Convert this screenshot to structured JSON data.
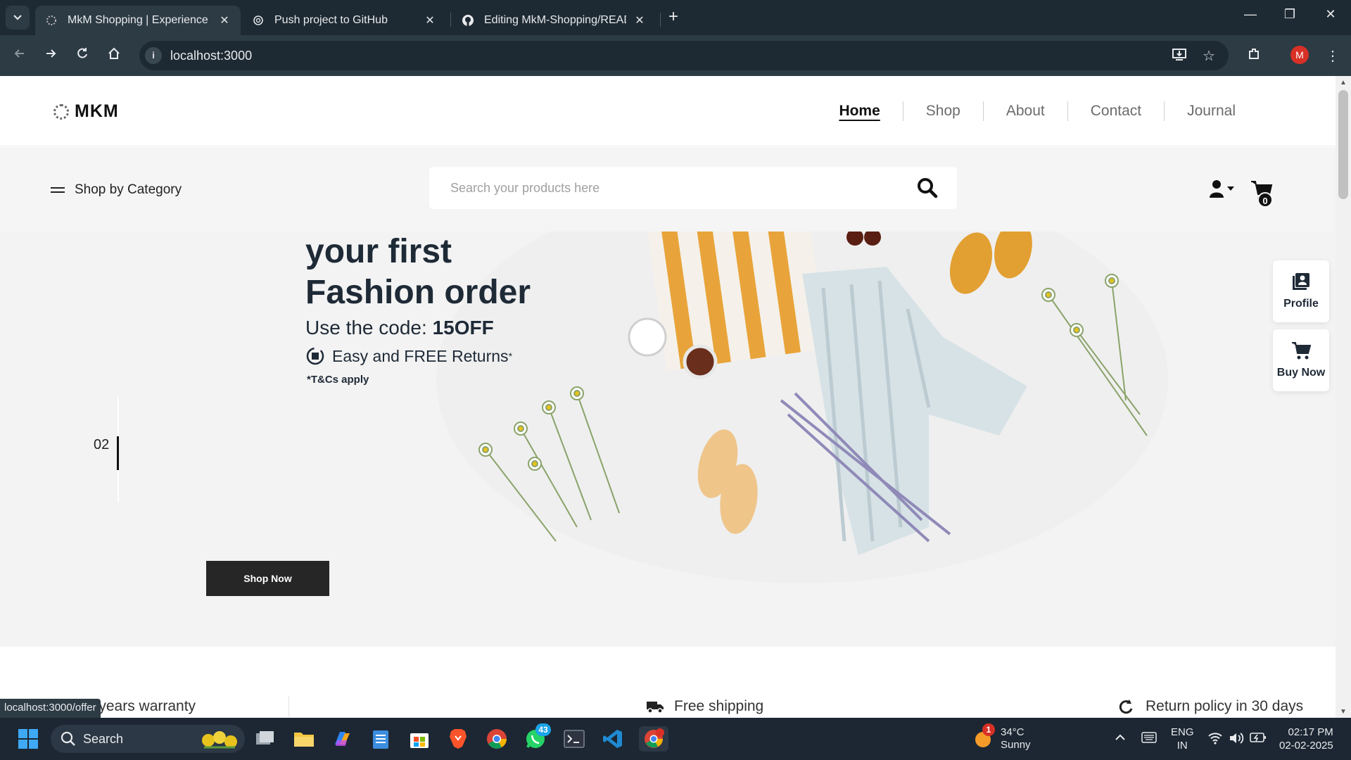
{
  "browser": {
    "tabs": [
      {
        "title": "MkM Shopping | Experience the",
        "favicon": "mkm-favicon-icon",
        "active": true
      },
      {
        "title": "Push project to GitHub",
        "favicon": "chatgpt-icon",
        "active": false
      },
      {
        "title": "Editing MkM-Shopping/READM",
        "favicon": "github-icon",
        "active": false
      }
    ],
    "url": "localhost:3000",
    "profile_initial": "M",
    "status_url": "localhost:3000/offer"
  },
  "site": {
    "logo_text": "MKM",
    "nav": [
      "Home",
      "Shop",
      "About",
      "Contact",
      "Journal"
    ],
    "active_nav": "Home",
    "shop_by_category": "Shop by Category",
    "search_placeholder": "Search your products here",
    "cart_count": "0"
  },
  "hero": {
    "title_line1": "your first",
    "title_line2": "Fashion order",
    "code_prefix": "Use the code: ",
    "code": "15OFF",
    "returns": "Easy and FREE Returns",
    "returns_mark": "*",
    "tc": "*T&Cs apply",
    "slide_number": "02",
    "cta": "Shop Now"
  },
  "floating": {
    "profile": "Profile",
    "buy_now": "Buy Now"
  },
  "features": {
    "warranty": "Two years warranty",
    "shipping": "Free shipping",
    "returns": "Return policy in 30 days"
  },
  "taskbar": {
    "search": "Search",
    "whatsapp_badge": "43",
    "weather_badge": "1",
    "temperature": "34°C",
    "condition": "Sunny",
    "lang_line1": "ENG",
    "lang_line2": "IN",
    "time": "02:17 PM",
    "date": "02-02-2025"
  },
  "colors": {
    "chrome_dark": "#1e2a33",
    "chrome_toolbar": "#2d3b45",
    "hero_bg": "#f3f3f3",
    "hero_text": "#1f2a37",
    "cta_bg": "#262626",
    "taskbar_bg": "#1c2733"
  }
}
